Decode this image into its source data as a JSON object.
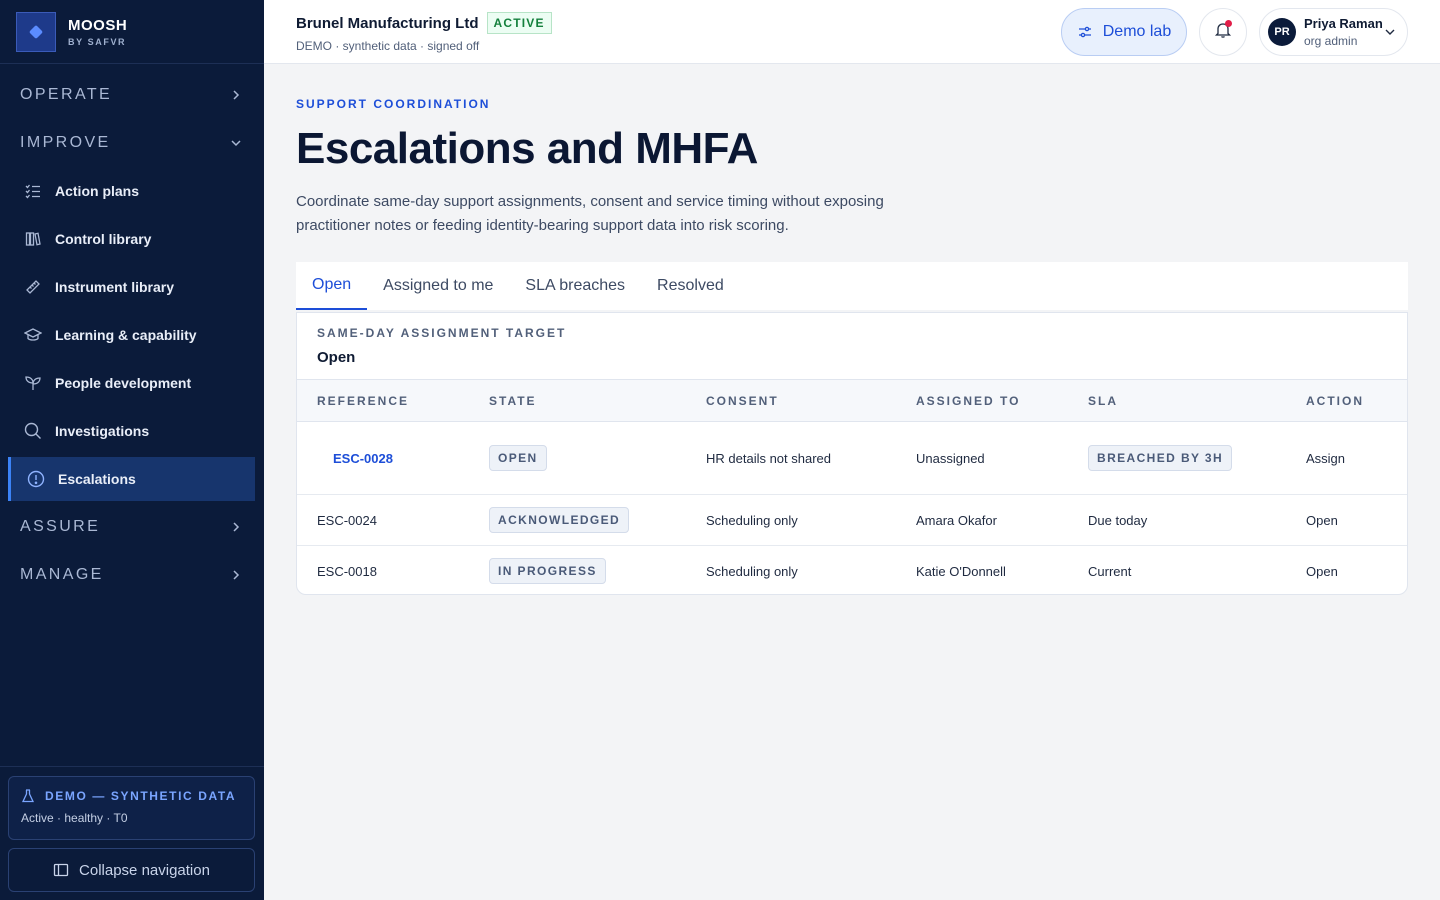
{
  "brand": {
    "name": "MOOSH",
    "sub": "BY SAFVR"
  },
  "sidebar": {
    "sections": [
      {
        "label": "OPERATE",
        "expanded": false
      },
      {
        "label": "IMPROVE",
        "expanded": true
      },
      {
        "label": "ASSURE",
        "expanded": false
      },
      {
        "label": "MANAGE",
        "expanded": false
      }
    ],
    "items": [
      {
        "label": "Action plans",
        "icon": "checklist-icon"
      },
      {
        "label": "Control library",
        "icon": "books-icon"
      },
      {
        "label": "Instrument library",
        "icon": "ruler-icon"
      },
      {
        "label": "Learning & capability",
        "icon": "graduation-cap-icon"
      },
      {
        "label": "People development",
        "icon": "sprout-icon"
      },
      {
        "label": "Investigations",
        "icon": "search-icon"
      },
      {
        "label": "Escalations",
        "icon": "alert-circle-icon",
        "active": true
      }
    ],
    "demo": {
      "title": "DEMO — SYNTHETIC DATA",
      "sub": "Active · healthy · T0"
    },
    "collapse_label": "Collapse navigation"
  },
  "header": {
    "org_name": "Brunel Manufacturing Ltd",
    "org_status": "ACTIVE",
    "org_sub": "DEMO · synthetic data · signed off",
    "demo_lab_label": "Demo lab",
    "user": {
      "initials": "PR",
      "name": "Priya Raman",
      "role": "org admin"
    }
  },
  "page": {
    "eyebrow": "SUPPORT COORDINATION",
    "title": "Escalations and MHFA",
    "description": "Coordinate same-day support assignments, consent and service timing without exposing practitioner notes or feeding identity-bearing support data into risk scoring."
  },
  "tabs": [
    {
      "label": "Open",
      "active": true
    },
    {
      "label": "Assigned to me"
    },
    {
      "label": "SLA breaches"
    },
    {
      "label": "Resolved"
    }
  ],
  "card": {
    "label": "SAME-DAY ASSIGNMENT TARGET",
    "value": "Open"
  },
  "table": {
    "columns": [
      "REFERENCE",
      "STATE",
      "CONSENT",
      "ASSIGNED TO",
      "SLA",
      "ACTION"
    ],
    "rows": [
      {
        "reference": "ESC-0028",
        "state": "OPEN",
        "consent": "HR details not shared",
        "assigned_to": "Unassigned",
        "sla": "BREACHED BY 3H",
        "action": "Assign"
      },
      {
        "reference": "ESC-0024",
        "state": "ACKNOWLEDGED",
        "consent": "Scheduling only",
        "assigned_to": "Amara Okafor",
        "sla": "Due today",
        "action": "Open"
      },
      {
        "reference": "ESC-0018",
        "state": "IN PROGRESS",
        "consent": "Scheduling only",
        "assigned_to": "Katie O'Donnell",
        "sla": "Current",
        "action": "Open"
      }
    ]
  },
  "colors": {
    "sidebar_bg": "#0b1b3a",
    "accent": "#1d4ed8",
    "active_green": "#15803d",
    "notify_dot": "#e11d48"
  }
}
